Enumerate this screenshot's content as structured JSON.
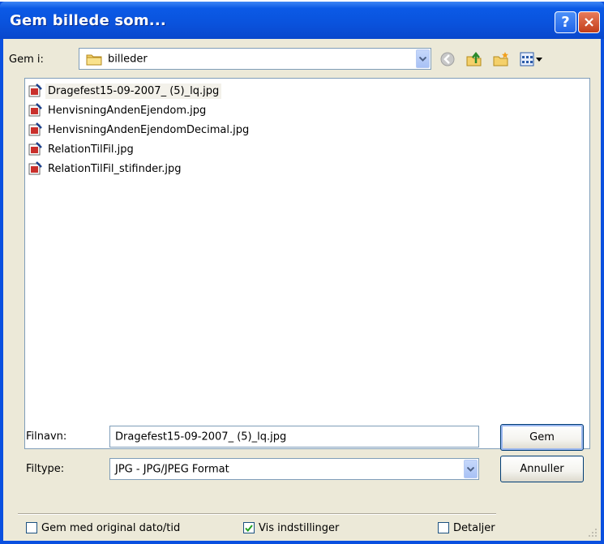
{
  "window": {
    "title": "Gem billede som..."
  },
  "titlebar": {
    "help_glyph": "?",
    "close_glyph": "×"
  },
  "lookin": {
    "label": "Gem i:",
    "value": "billeder"
  },
  "toolbar": {
    "icons": [
      "back-icon",
      "up-folder-icon",
      "new-folder-icon",
      "view-menu-icon"
    ]
  },
  "files": [
    {
      "name": "Dragefest15-09-2007_ (5)_lq.jpg",
      "selected": true
    },
    {
      "name": "HenvisningAndenEjendom.jpg"
    },
    {
      "name": "HenvisningAndenEjendomDecimal.jpg"
    },
    {
      "name": "RelationTilFil.jpg"
    },
    {
      "name": "RelationTilFil_stifinder.jpg"
    }
  ],
  "filename": {
    "label": "Filnavn:",
    "value": "Dragefest15-09-2007_ (5)_lq.jpg"
  },
  "filetype": {
    "label": "Filtype:",
    "value": "JPG - JPG/JPEG Format"
  },
  "buttons": {
    "save": "Gem",
    "cancel": "Annuller"
  },
  "options": {
    "keep_date": {
      "label": "Gem med original dato/tid",
      "checked": false
    },
    "show_settings": {
      "label": "Vis indstillinger",
      "checked": true
    },
    "details": {
      "label": "Detaljer",
      "checked": false
    }
  },
  "colors": {
    "titlebar": "#0a52dc",
    "face": "#ece9d8",
    "border": "#7f9db9"
  }
}
